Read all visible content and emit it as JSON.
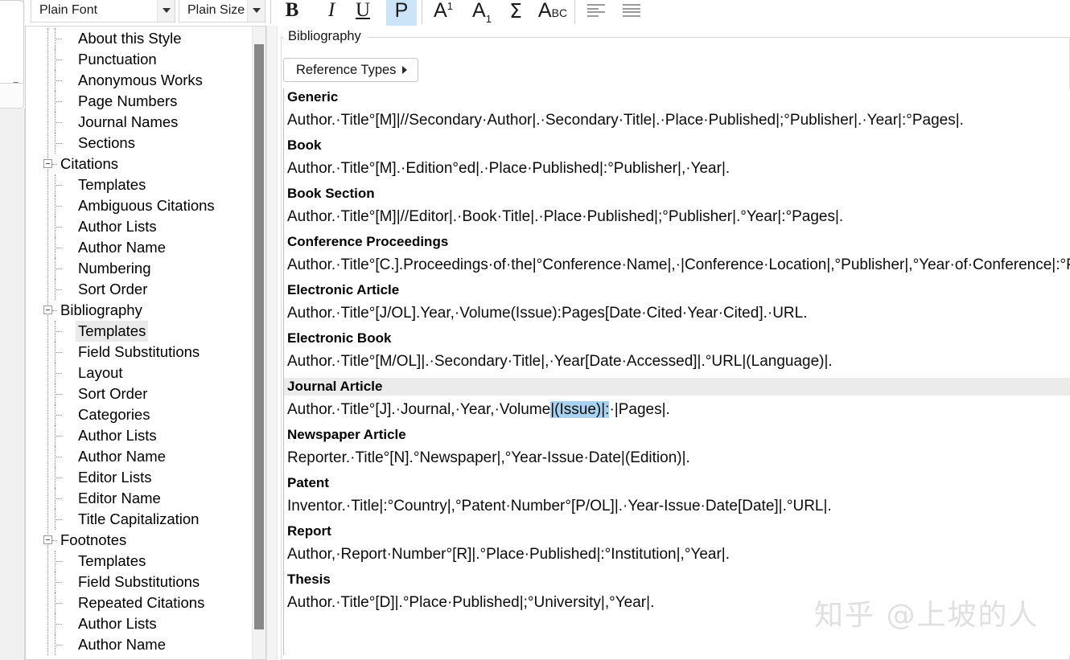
{
  "toolbar": {
    "font_combo": {
      "value": "Plain Font"
    },
    "size_combo": {
      "value": "Plain Size"
    },
    "buttons": [
      {
        "name": "bold-button",
        "glyph": "B"
      },
      {
        "name": "italic-button",
        "glyph": "I"
      },
      {
        "name": "underline-button",
        "glyph": "U"
      },
      {
        "name": "plain-button",
        "glyph": "P",
        "active": true
      },
      {
        "name": "superscript-button",
        "glyph": "A",
        "mod": "1"
      },
      {
        "name": "subscript-button",
        "glyph": "A",
        "mod": "1"
      },
      {
        "name": "symbol-button",
        "glyph": "Σ"
      },
      {
        "name": "spellcheck-button",
        "glyph": "A",
        "mod": "BC"
      },
      {
        "name": "align-left-button",
        "glyph": "align-left-icon"
      },
      {
        "name": "align-justify-button",
        "glyph": "align-justify-icon"
      }
    ]
  },
  "sidebar": {
    "items": [
      {
        "label": "About this Style",
        "depth": 1,
        "expander": false,
        "selected": false
      },
      {
        "label": "Punctuation",
        "depth": 1,
        "expander": false,
        "selected": false
      },
      {
        "label": "Anonymous Works",
        "depth": 1,
        "expander": false,
        "selected": false
      },
      {
        "label": "Page Numbers",
        "depth": 1,
        "expander": false,
        "selected": false
      },
      {
        "label": "Journal Names",
        "depth": 1,
        "expander": false,
        "selected": false
      },
      {
        "label": "Sections",
        "depth": 1,
        "expander": false,
        "selected": false
      },
      {
        "label": "Citations",
        "depth": 0,
        "expander": true,
        "selected": false
      },
      {
        "label": "Templates",
        "depth": 1,
        "expander": false,
        "selected": false
      },
      {
        "label": "Ambiguous Citations",
        "depth": 1,
        "expander": false,
        "selected": false
      },
      {
        "label": "Author Lists",
        "depth": 1,
        "expander": false,
        "selected": false
      },
      {
        "label": "Author Name",
        "depth": 1,
        "expander": false,
        "selected": false
      },
      {
        "label": "Numbering",
        "depth": 1,
        "expander": false,
        "selected": false
      },
      {
        "label": "Sort Order",
        "depth": 1,
        "expander": false,
        "selected": false
      },
      {
        "label": "Bibliography",
        "depth": 0,
        "expander": true,
        "selected": false
      },
      {
        "label": "Templates",
        "depth": 1,
        "expander": false,
        "selected": true
      },
      {
        "label": "Field Substitutions",
        "depth": 1,
        "expander": false,
        "selected": false
      },
      {
        "label": "Layout",
        "depth": 1,
        "expander": false,
        "selected": false
      },
      {
        "label": "Sort Order",
        "depth": 1,
        "expander": false,
        "selected": false
      },
      {
        "label": "Categories",
        "depth": 1,
        "expander": false,
        "selected": false
      },
      {
        "label": "Author Lists",
        "depth": 1,
        "expander": false,
        "selected": false
      },
      {
        "label": "Author Name",
        "depth": 1,
        "expander": false,
        "selected": false
      },
      {
        "label": "Editor Lists",
        "depth": 1,
        "expander": false,
        "selected": false
      },
      {
        "label": "Editor Name",
        "depth": 1,
        "expander": false,
        "selected": false
      },
      {
        "label": "Title Capitalization",
        "depth": 1,
        "expander": false,
        "selected": false
      },
      {
        "label": "Footnotes",
        "depth": 0,
        "expander": true,
        "selected": false
      },
      {
        "label": "Templates",
        "depth": 1,
        "expander": false,
        "selected": false
      },
      {
        "label": "Field Substitutions",
        "depth": 1,
        "expander": false,
        "selected": false
      },
      {
        "label": "Repeated Citations",
        "depth": 1,
        "expander": false,
        "selected": false
      },
      {
        "label": "Author Lists",
        "depth": 1,
        "expander": false,
        "selected": false
      },
      {
        "label": "Author Name",
        "depth": 1,
        "expander": false,
        "selected": false
      }
    ]
  },
  "main": {
    "group_title": "Bibliography",
    "reference_types_label": "Reference Types",
    "templates": [
      {
        "type": "Generic",
        "highlighted": false,
        "segments": [
          {
            "text": "Author.·Title°[M]|//Secondary·Author|.·Secondary·Title|.·Place·Published|;°Publisher|.·Year|:°Pages|.",
            "selected": false
          }
        ]
      },
      {
        "type": "Book",
        "highlighted": false,
        "segments": [
          {
            "text": "Author.·Title°[M].·Edition°ed|.·Place·Published|:°Publisher|,·Year|.",
            "selected": false
          }
        ]
      },
      {
        "type": "Book Section",
        "highlighted": false,
        "segments": [
          {
            "text": "Author.·Title°[M]|//Editor|.·Book·Title|.·Place·Published|;°Publisher|.°Year|:°Pages|.",
            "selected": false
          }
        ]
      },
      {
        "type": "Conference Proceedings",
        "highlighted": false,
        "segments": [
          {
            "text": "Author.·Title°[C.].Proceedings·of·the|°Conference·Name|,·|Conference·Location|,°Publisher|,°Year·of·Conference|:°Pages|.",
            "selected": false
          }
        ]
      },
      {
        "type": "Electronic Article",
        "highlighted": false,
        "segments": [
          {
            "text": "Author.·Title°[J/OL].Year,·Volume(Issue):Pages[Date·Cited·Year·Cited].·URL.",
            "selected": false
          }
        ]
      },
      {
        "type": "Electronic Book",
        "highlighted": false,
        "segments": [
          {
            "text": "Author.·Title°[M/OL]|.·Secondary·Title|,·Year[Date·Accessed]|.°URL|(Language)|.",
            "selected": false
          }
        ]
      },
      {
        "type": "Journal Article",
        "highlighted": true,
        "segments": [
          {
            "text": "Author.·Title°[J].·Journal,·Year,·Volume",
            "selected": false
          },
          {
            "text": "|(Issue)|:",
            "selected": true
          },
          {
            "text": "·|Pages|.",
            "selected": false
          }
        ]
      },
      {
        "type": "Newspaper Article",
        "highlighted": false,
        "segments": [
          {
            "text": "Reporter.·Title°[N].°Newspaper|,°Year-Issue·Date|(Edition)|.",
            "selected": false
          }
        ]
      },
      {
        "type": "Patent",
        "highlighted": false,
        "segments": [
          {
            "text": "Inventor.·Title|:°Country|,°Patent·Number°[P/OL]|.·Year-Issue·Date[Date]|.°URL|.",
            "selected": false
          }
        ]
      },
      {
        "type": "Report",
        "highlighted": false,
        "segments": [
          {
            "text": "Author,·Report·Number°[R]|.°Place·Published|:°Institution|,°Year|.",
            "selected": false
          }
        ]
      },
      {
        "type": "Thesis",
        "highlighted": false,
        "segments": [
          {
            "text": "Author.·Title°[D]|.°Place·Published|;°University|,°Year|.",
            "selected": false
          }
        ]
      }
    ]
  },
  "watermark": {
    "text": "知乎 @上坡的人"
  },
  "colors": {
    "selection_blue": "#a9d2f0",
    "active_toolbar": "#cce4f7",
    "row_highlight": "#ebebeb",
    "tree_selection": "#eaeaea"
  }
}
